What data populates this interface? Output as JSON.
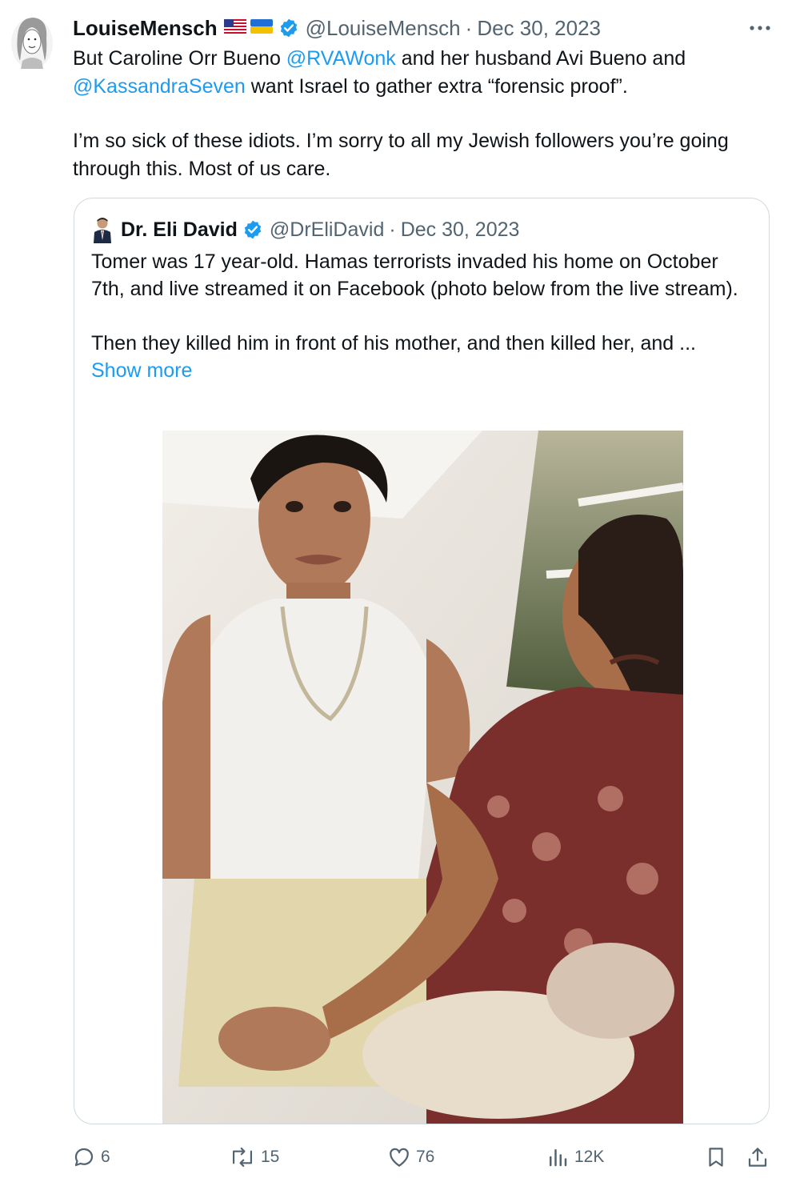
{
  "tweet": {
    "author_name": "LouiseMensch",
    "author_flags": "🇺🇸🇺🇦",
    "handle": "@LouiseMensch",
    "separator": "·",
    "date": "Dec 30, 2023",
    "text_1a": "But Caroline Orr Bueno ",
    "mention_1": "@RVAWonk",
    "text_1b": " and her husband Avi Bueno and ",
    "mention_2": "@KassandraSeven",
    "text_1c": " want Israel to gather extra “forensic proof”.",
    "text_2": "I’m so sick of these idiots. I’m sorry to all my Jewish followers you’re going through this. Most of us care."
  },
  "quote": {
    "author_name": "Dr. Eli David",
    "handle": "@DrEliDavid",
    "separator": "·",
    "date": "Dec 30, 2023",
    "text_1": "Tomer was 17 year-old. Hamas terrorists invaded his home on October 7th, and live streamed it on Facebook (photo below from the live stream).",
    "text_2": "Then they killed him in front of his mother, and then killed her, and ...",
    "show_more": "Show more"
  },
  "actions": {
    "replies": "6",
    "reposts": "15",
    "likes": "76",
    "views": "12K"
  },
  "colors": {
    "accent": "#1d9bf0",
    "secondary_text": "#536471",
    "border": "#cfd9de"
  },
  "icons": [
    "more-icon",
    "verified-badge-icon",
    "reply-icon",
    "repost-icon",
    "like-icon",
    "views-icon",
    "bookmark-icon",
    "share-icon"
  ]
}
